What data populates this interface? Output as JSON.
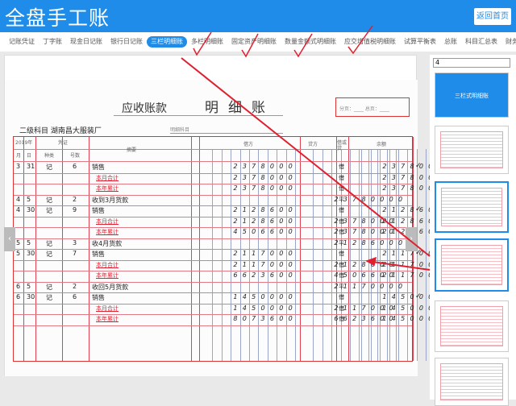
{
  "header": {
    "title": "全盘手工账",
    "home_button": "返回首页"
  },
  "nav": [
    "记账凭证",
    "丁字账",
    "现金日记账",
    "银行日记账",
    "三栏明细账",
    "多栏明细账",
    "固定资产明细账",
    "数量金额式明细账",
    "应交增值税明细账",
    "试算平衡表",
    "总账",
    "科目汇总表",
    "财务报表"
  ],
  "nav_active": 4,
  "ledger": {
    "account": "应收账款",
    "title": "明细账",
    "sign": "分页：____ 总页：____",
    "sub_account": "二级科目 湖南昌大服装厂",
    "sub_account2": "明细科目",
    "headers": {
      "year": "2019年",
      "voucher": "凭证",
      "month": "月",
      "day": "日",
      "type": "种类",
      "num": "号数",
      "summary": "摘要",
      "debit": "借方",
      "credit": "贷方",
      "dc": "借或贷",
      "balance": "余额"
    },
    "rows": [
      {
        "m": "3",
        "d": "31",
        "t": "记",
        "n": "6",
        "s": "销售",
        "debit": "2378000",
        "credit": "",
        "dc": "借",
        "bal": "2378000",
        "chk": true
      },
      {
        "s": "本月合计",
        "red": true,
        "debit": "2378000",
        "credit": "",
        "dc": "借",
        "bal": "2378000"
      },
      {
        "s": "本年累计",
        "red": true,
        "debit": "2378000",
        "credit": "",
        "dc": "借",
        "bal": "2378000"
      },
      {
        "m": "4",
        "d": "5",
        "t": "记",
        "n": "2",
        "s": "收到3月货款",
        "debit": "",
        "credit": "2378000",
        "dc": "平",
        "bal": "0"
      },
      {
        "m": "4",
        "d": "30",
        "t": "记",
        "n": "9",
        "s": "销售",
        "debit": "2128600",
        "credit": "",
        "dc": "借",
        "bal": "2128600",
        "chk": true
      },
      {
        "s": "本月合计",
        "red": true,
        "debit": "2128600",
        "credit": "2378000",
        "dc": "借",
        "bal": "2128600"
      },
      {
        "s": "本年累计",
        "red": true,
        "debit": "4506600",
        "credit": "2378000",
        "dc": "借",
        "bal": "2128600"
      },
      {
        "m": "5",
        "d": "5",
        "t": "记",
        "n": "3",
        "s": "收4月货款",
        "debit": "",
        "credit": "2128600",
        "dc": "平",
        "bal": "0"
      },
      {
        "m": "5",
        "d": "30",
        "t": "记",
        "n": "7",
        "s": "销售",
        "debit": "2117000",
        "credit": "",
        "dc": "借",
        "bal": "2117000",
        "chk": true
      },
      {
        "s": "本月合计",
        "red": true,
        "debit": "2117000",
        "credit": "2128600",
        "dc": "借",
        "bal": "2117000"
      },
      {
        "s": "本年累计",
        "red": true,
        "debit": "6623600",
        "credit": "4506600",
        "dc": "借",
        "bal": "2117000"
      },
      {
        "m": "6",
        "d": "5",
        "t": "记",
        "n": "2",
        "s": "收回5月货款",
        "debit": "",
        "credit": "2117000",
        "dc": "平",
        "bal": "0"
      },
      {
        "m": "6",
        "d": "30",
        "t": "记",
        "n": "6",
        "s": "销售",
        "debit": "1450000",
        "credit": "",
        "dc": "借",
        "bal": "1450000",
        "chk": true
      },
      {
        "s": "本月合计",
        "red": true,
        "debit": "1450000",
        "credit": "2117000",
        "dc": "借",
        "bal": "1450000"
      },
      {
        "s": "本年累计",
        "red": true,
        "debit": "8073600",
        "credit": "6623600",
        "dc": "借",
        "bal": "1450000"
      }
    ]
  },
  "sidebar": {
    "page_select": "4",
    "banner": "三栏式明细账"
  },
  "colors": {
    "brand": "#1e8ce8",
    "annotation": "#e02030"
  }
}
